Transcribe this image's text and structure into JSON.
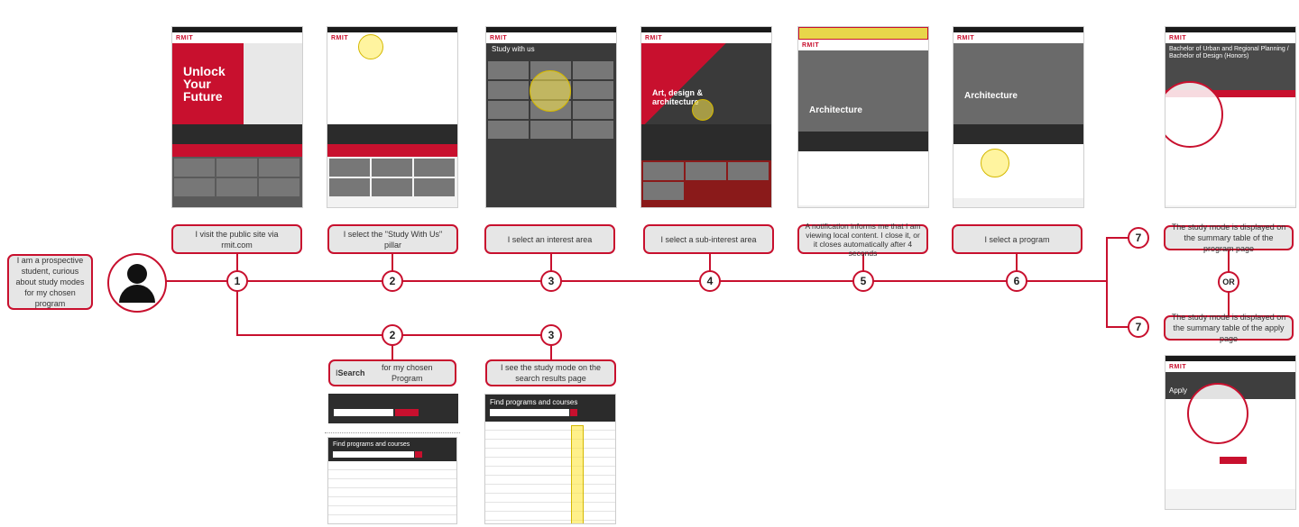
{
  "persona": "I am a prospective student, curious about study modes for my chosen program",
  "steps": [
    {
      "num": "1",
      "label": "I visit the public site via rmit.com"
    },
    {
      "num": "2",
      "label": "I select the \"Study With Us\" pillar"
    },
    {
      "num": "3",
      "label": "I select an interest area"
    },
    {
      "num": "4",
      "label": "I select a sub-interest area"
    },
    {
      "num": "5",
      "label": "A notification informs me that I am viewing local content. I close it, or it closes automatically after 4 seconds"
    },
    {
      "num": "6",
      "label": "I select a program"
    }
  ],
  "alt_steps": [
    {
      "num": "2",
      "label_pre": "I ",
      "label_bold": "Search",
      "label_post": " for my chosen Program"
    },
    {
      "num": "3",
      "label": "I see the study mode on the search results page"
    }
  ],
  "outcomes": [
    {
      "num": "7",
      "label": "The study mode is displayed on the summary table of the program page"
    },
    {
      "num": "7",
      "label": "The study mode is displayed on the summary table of the apply page"
    }
  ],
  "or_label": "OR",
  "screens": {
    "logo": "RMIT",
    "s1_hero": "Unlock Your Future",
    "s3_hero": "Study with us",
    "s4_hero": "Art, design & architecture",
    "s5_hero": "Architecture",
    "s6_hero": "Architecture",
    "s7_hero": "Bachelor of Urban and Regional Planning / Bachelor of Design (Honors)",
    "s8_hero": "Apply",
    "search_panel_title": "Find programs and courses",
    "search_panel_title2": "Find programs and courses"
  },
  "colors": {
    "accent": "#c8102e",
    "bubble": "#e6e6e6",
    "highlight": "#ffeb50"
  }
}
